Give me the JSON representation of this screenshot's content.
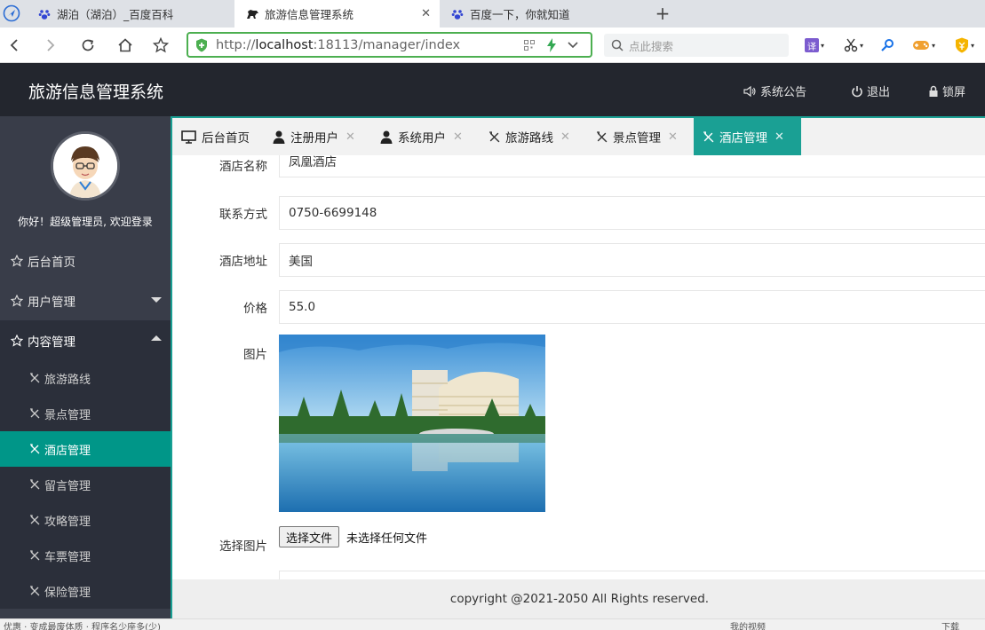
{
  "browser": {
    "tabs": [
      {
        "title": "湖泊（湖泊）_百度百科",
        "active": false,
        "closable": false
      },
      {
        "title": "旅游信息管理系统",
        "active": true,
        "closable": true
      },
      {
        "title": "百度一下，你就知道",
        "active": false,
        "closable": false
      }
    ],
    "close_glyph": "✕",
    "new_tab_glyph": "+",
    "url_scheme": "http://",
    "url_host": "localhost",
    "url_rest": ":18113/manager/index",
    "search_placeholder": "点此搜索",
    "ext_translate": "译",
    "accent": "#4caf50"
  },
  "header": {
    "title": "旅游信息管理系统",
    "announce": "系统公告",
    "logout": "退出",
    "lock": "锁屏",
    "bg": "#23262e"
  },
  "sidebar": {
    "welcome": "你好！超级管理员, 欢迎登录",
    "menu": [
      {
        "label": "后台首页"
      },
      {
        "label": "用户管理",
        "expanded": false
      },
      {
        "label": "内容管理",
        "expanded": true
      }
    ],
    "submenu": [
      {
        "label": "旅游路线",
        "active": false
      },
      {
        "label": "景点管理",
        "active": false
      },
      {
        "label": "酒店管理",
        "active": true
      },
      {
        "label": "留言管理",
        "active": false
      },
      {
        "label": "攻略管理",
        "active": false
      },
      {
        "label": "车票管理",
        "active": false
      },
      {
        "label": "保险管理",
        "active": false
      }
    ],
    "active_color": "#009688",
    "bg": "#393d49"
  },
  "content_tabs": [
    {
      "label": "后台首页",
      "icon": "monitor-icon",
      "closable": false,
      "active": false
    },
    {
      "label": "注册用户",
      "icon": "user-icon",
      "closable": true,
      "active": false
    },
    {
      "label": "系统用户",
      "icon": "user-icon",
      "closable": true,
      "active": false
    },
    {
      "label": "旅游路线",
      "icon": "tools-icon",
      "closable": true,
      "active": false
    },
    {
      "label": "景点管理",
      "icon": "tools-icon",
      "closable": true,
      "active": false
    },
    {
      "label": "酒店管理",
      "icon": "tools-icon",
      "closable": true,
      "active": true
    }
  ],
  "form": {
    "hotel_name_label": "酒店名称",
    "hotel_name_value": "凤凰酒店",
    "contact_label": "联系方式",
    "contact_value": "0750-6699148",
    "address_label": "酒店地址",
    "address_value": "美国",
    "price_label": "价格",
    "price_value": "55.0",
    "image_label": "图片",
    "choose_image_label": "选择图片",
    "file_button": "选择文件",
    "file_status": "未选择任何文件"
  },
  "footer": {
    "copyright": "copyright @2021-2050 All Rights reserved."
  },
  "statusbar": {
    "left": "优惠 · 变成最废体质 · 程序名少座多(少)",
    "right1": "我的视频",
    "right2": "下载"
  }
}
